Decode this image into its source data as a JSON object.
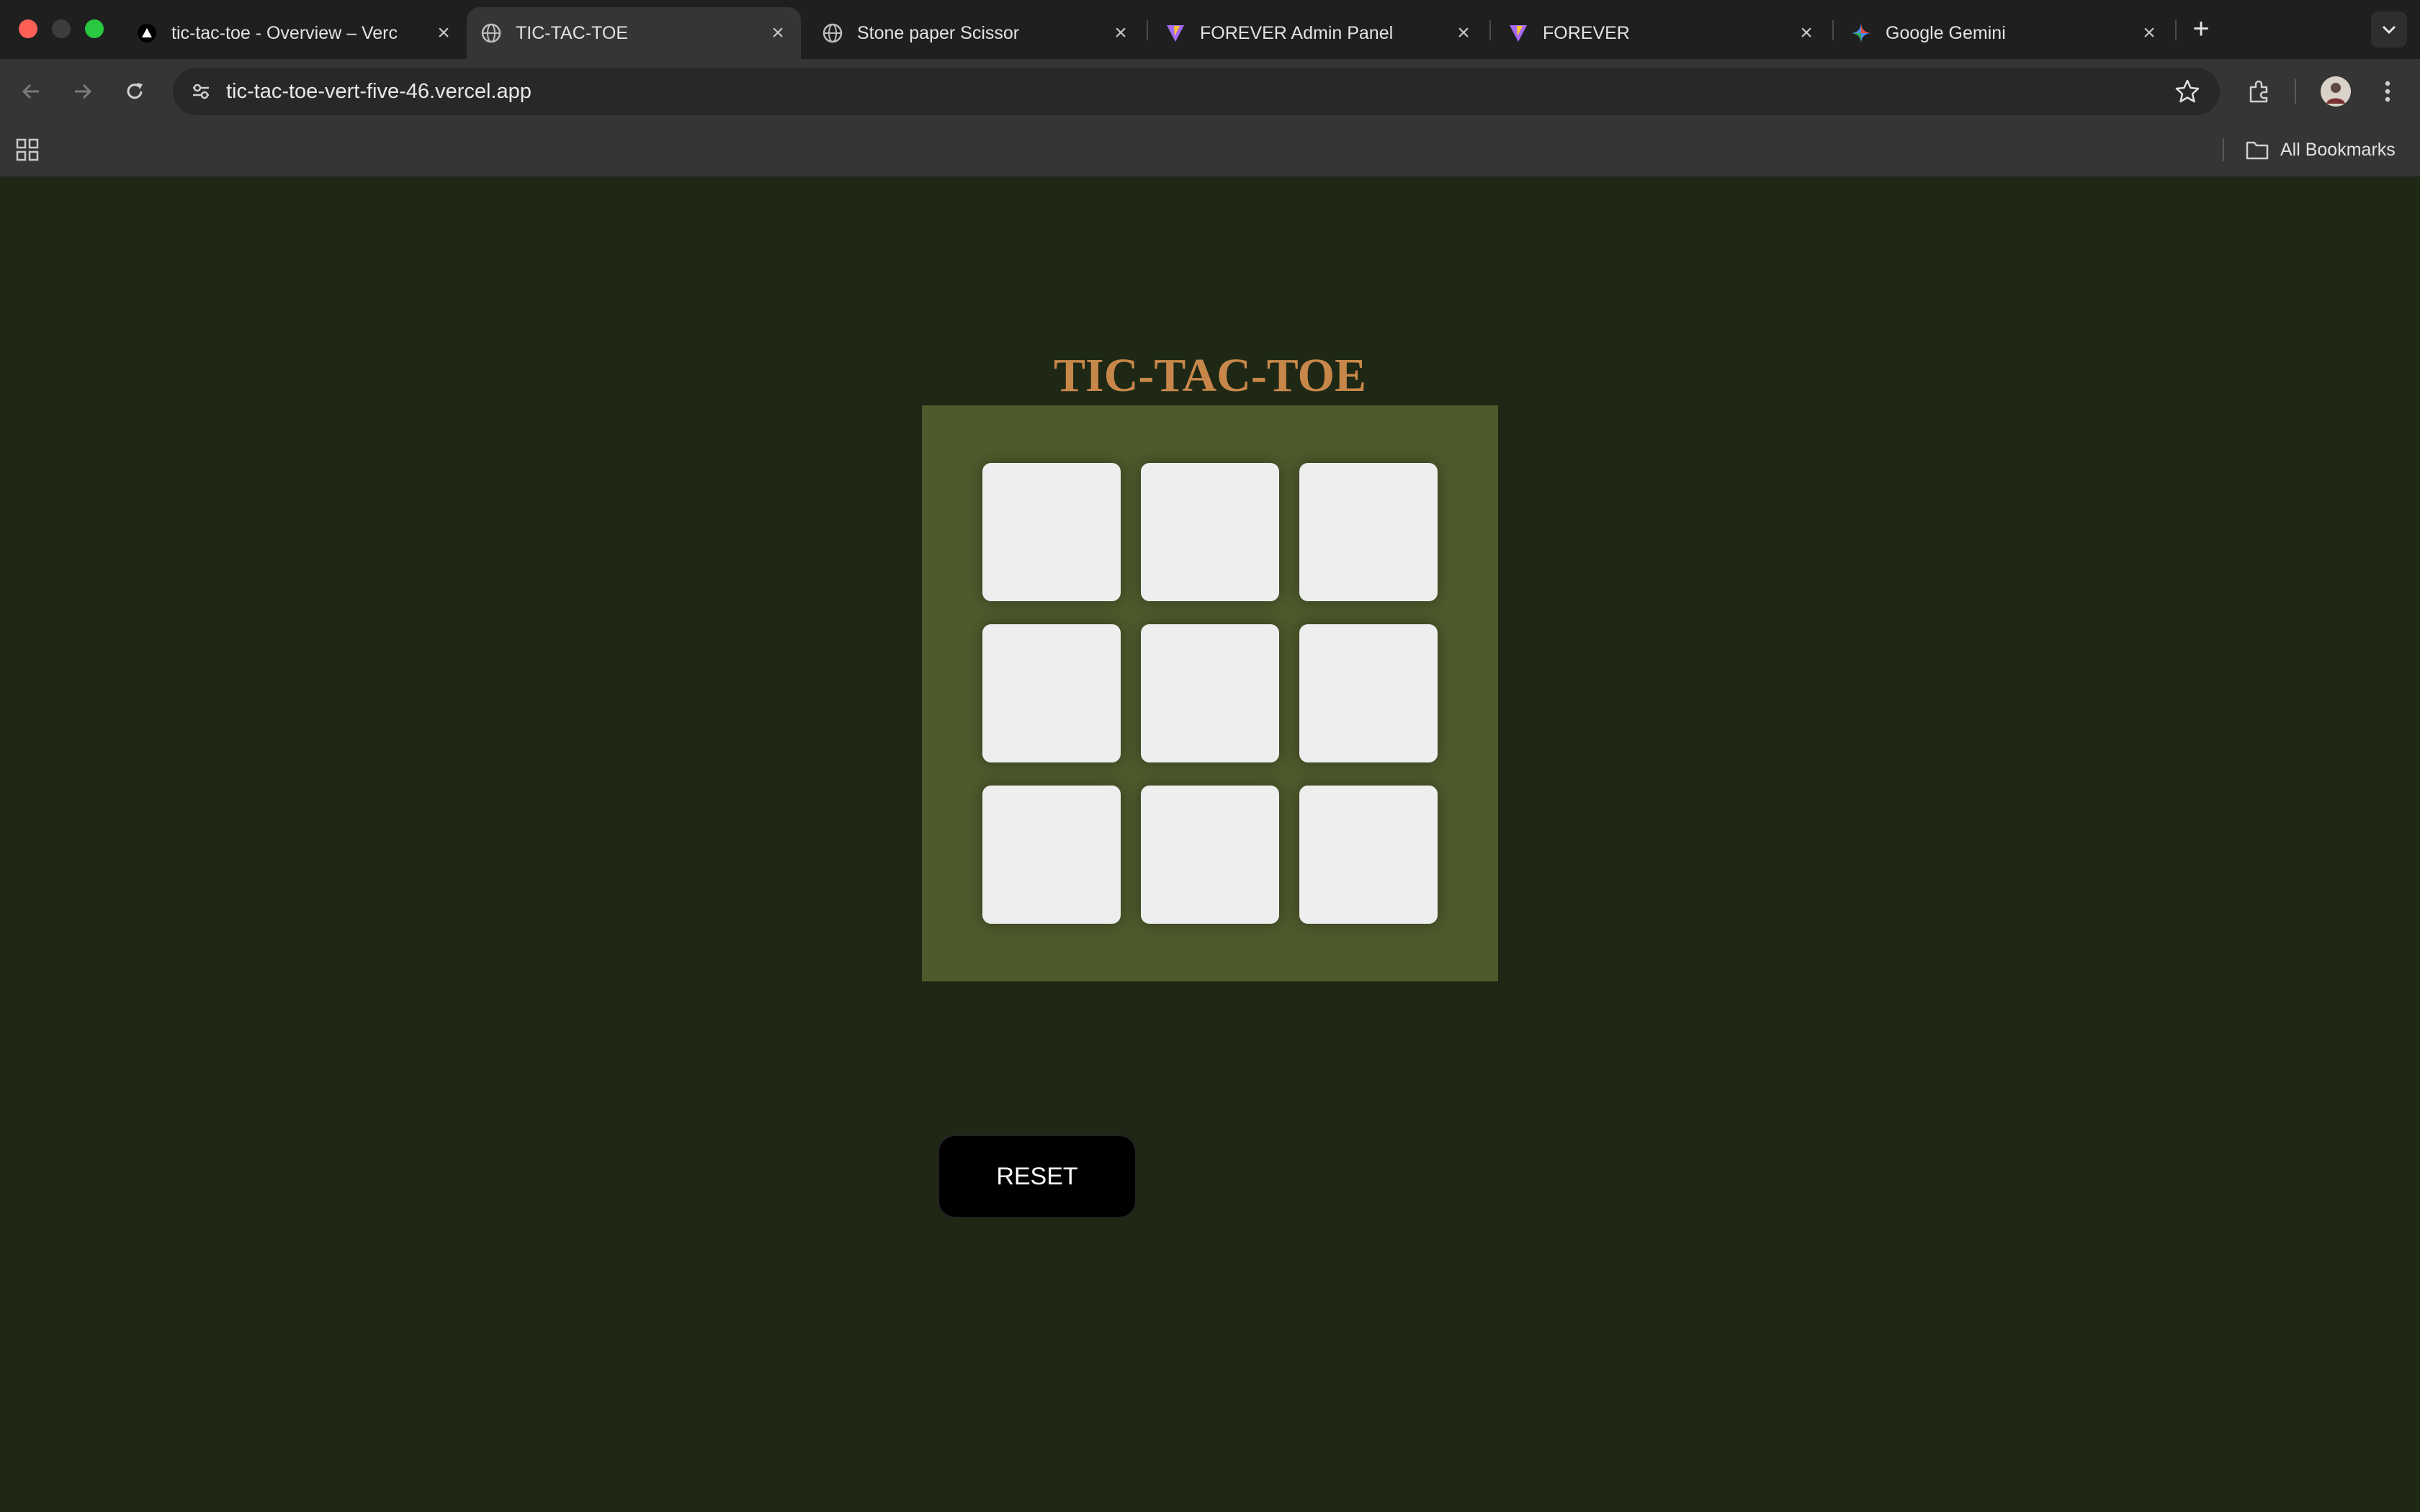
{
  "browser": {
    "tabs": [
      {
        "title": "tic-tac-toe - Overview – Verc",
        "icon": "vercel-triangle-icon",
        "active": false
      },
      {
        "title": "TIC-TAC-TOE",
        "icon": "globe-icon",
        "active": true
      },
      {
        "title": "Stone paper Scissor",
        "icon": "globe-icon",
        "active": false
      },
      {
        "title": "FOREVER Admin Panel",
        "icon": "vite-logo-icon",
        "active": false
      },
      {
        "title": "FOREVER",
        "icon": "vite-logo-icon",
        "active": false
      },
      {
        "title": "Google Gemini",
        "icon": "gemini-sparkle-icon",
        "active": false
      }
    ],
    "address": "tic-tac-toe-vert-five-46.vercel.app",
    "bookmarks_label": "All Bookmarks"
  },
  "game": {
    "title": "TIC-TAC-TOE",
    "cells": [
      "",
      "",
      "",
      "",
      "",
      "",
      "",
      "",
      ""
    ],
    "reset_label": "RESET"
  },
  "colors": {
    "page_background": "#1e2815",
    "board_background": "#4e5a2c",
    "cell_background": "#eeeeee",
    "title_color": "#c8874a",
    "reset_background": "#000000"
  }
}
